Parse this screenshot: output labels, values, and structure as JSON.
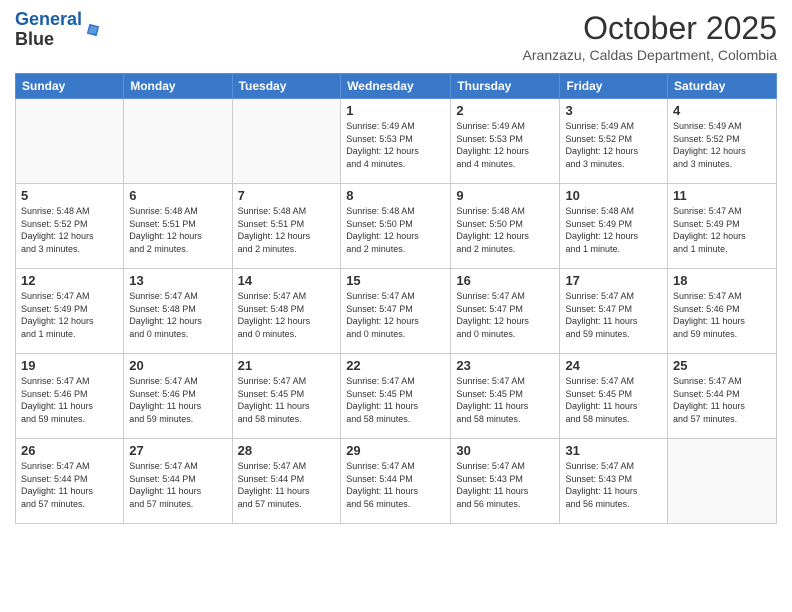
{
  "header": {
    "logo_line1": "General",
    "logo_line2": "Blue",
    "month": "October 2025",
    "location": "Aranzazu, Caldas Department, Colombia"
  },
  "weekdays": [
    "Sunday",
    "Monday",
    "Tuesday",
    "Wednesday",
    "Thursday",
    "Friday",
    "Saturday"
  ],
  "weeks": [
    [
      {
        "day": "",
        "info": ""
      },
      {
        "day": "",
        "info": ""
      },
      {
        "day": "",
        "info": ""
      },
      {
        "day": "1",
        "info": "Sunrise: 5:49 AM\nSunset: 5:53 PM\nDaylight: 12 hours\nand 4 minutes."
      },
      {
        "day": "2",
        "info": "Sunrise: 5:49 AM\nSunset: 5:53 PM\nDaylight: 12 hours\nand 4 minutes."
      },
      {
        "day": "3",
        "info": "Sunrise: 5:49 AM\nSunset: 5:52 PM\nDaylight: 12 hours\nand 3 minutes."
      },
      {
        "day": "4",
        "info": "Sunrise: 5:49 AM\nSunset: 5:52 PM\nDaylight: 12 hours\nand 3 minutes."
      }
    ],
    [
      {
        "day": "5",
        "info": "Sunrise: 5:48 AM\nSunset: 5:52 PM\nDaylight: 12 hours\nand 3 minutes."
      },
      {
        "day": "6",
        "info": "Sunrise: 5:48 AM\nSunset: 5:51 PM\nDaylight: 12 hours\nand 2 minutes."
      },
      {
        "day": "7",
        "info": "Sunrise: 5:48 AM\nSunset: 5:51 PM\nDaylight: 12 hours\nand 2 minutes."
      },
      {
        "day": "8",
        "info": "Sunrise: 5:48 AM\nSunset: 5:50 PM\nDaylight: 12 hours\nand 2 minutes."
      },
      {
        "day": "9",
        "info": "Sunrise: 5:48 AM\nSunset: 5:50 PM\nDaylight: 12 hours\nand 2 minutes."
      },
      {
        "day": "10",
        "info": "Sunrise: 5:48 AM\nSunset: 5:49 PM\nDaylight: 12 hours\nand 1 minute."
      },
      {
        "day": "11",
        "info": "Sunrise: 5:47 AM\nSunset: 5:49 PM\nDaylight: 12 hours\nand 1 minute."
      }
    ],
    [
      {
        "day": "12",
        "info": "Sunrise: 5:47 AM\nSunset: 5:49 PM\nDaylight: 12 hours\nand 1 minute."
      },
      {
        "day": "13",
        "info": "Sunrise: 5:47 AM\nSunset: 5:48 PM\nDaylight: 12 hours\nand 0 minutes."
      },
      {
        "day": "14",
        "info": "Sunrise: 5:47 AM\nSunset: 5:48 PM\nDaylight: 12 hours\nand 0 minutes."
      },
      {
        "day": "15",
        "info": "Sunrise: 5:47 AM\nSunset: 5:47 PM\nDaylight: 12 hours\nand 0 minutes."
      },
      {
        "day": "16",
        "info": "Sunrise: 5:47 AM\nSunset: 5:47 PM\nDaylight: 12 hours\nand 0 minutes."
      },
      {
        "day": "17",
        "info": "Sunrise: 5:47 AM\nSunset: 5:47 PM\nDaylight: 11 hours\nand 59 minutes."
      },
      {
        "day": "18",
        "info": "Sunrise: 5:47 AM\nSunset: 5:46 PM\nDaylight: 11 hours\nand 59 minutes."
      }
    ],
    [
      {
        "day": "19",
        "info": "Sunrise: 5:47 AM\nSunset: 5:46 PM\nDaylight: 11 hours\nand 59 minutes."
      },
      {
        "day": "20",
        "info": "Sunrise: 5:47 AM\nSunset: 5:46 PM\nDaylight: 11 hours\nand 59 minutes."
      },
      {
        "day": "21",
        "info": "Sunrise: 5:47 AM\nSunset: 5:45 PM\nDaylight: 11 hours\nand 58 minutes."
      },
      {
        "day": "22",
        "info": "Sunrise: 5:47 AM\nSunset: 5:45 PM\nDaylight: 11 hours\nand 58 minutes."
      },
      {
        "day": "23",
        "info": "Sunrise: 5:47 AM\nSunset: 5:45 PM\nDaylight: 11 hours\nand 58 minutes."
      },
      {
        "day": "24",
        "info": "Sunrise: 5:47 AM\nSunset: 5:45 PM\nDaylight: 11 hours\nand 58 minutes."
      },
      {
        "day": "25",
        "info": "Sunrise: 5:47 AM\nSunset: 5:44 PM\nDaylight: 11 hours\nand 57 minutes."
      }
    ],
    [
      {
        "day": "26",
        "info": "Sunrise: 5:47 AM\nSunset: 5:44 PM\nDaylight: 11 hours\nand 57 minutes."
      },
      {
        "day": "27",
        "info": "Sunrise: 5:47 AM\nSunset: 5:44 PM\nDaylight: 11 hours\nand 57 minutes."
      },
      {
        "day": "28",
        "info": "Sunrise: 5:47 AM\nSunset: 5:44 PM\nDaylight: 11 hours\nand 57 minutes."
      },
      {
        "day": "29",
        "info": "Sunrise: 5:47 AM\nSunset: 5:44 PM\nDaylight: 11 hours\nand 56 minutes."
      },
      {
        "day": "30",
        "info": "Sunrise: 5:47 AM\nSunset: 5:43 PM\nDaylight: 11 hours\nand 56 minutes."
      },
      {
        "day": "31",
        "info": "Sunrise: 5:47 AM\nSunset: 5:43 PM\nDaylight: 11 hours\nand 56 minutes."
      },
      {
        "day": "",
        "info": ""
      }
    ]
  ]
}
